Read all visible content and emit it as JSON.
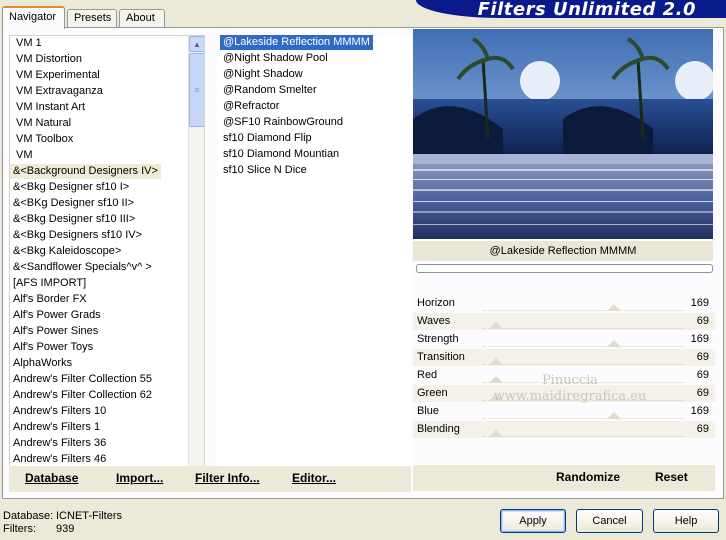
{
  "tabs": [
    "Navigator",
    "Presets",
    "About"
  ],
  "banner": "Filters Unlimited 2.0",
  "categories": [
    "VM 1",
    "VM Distortion",
    "VM Experimental",
    "VM Extravaganza",
    "VM Instant Art",
    "VM Natural",
    "VM Toolbox",
    "VM",
    "&<Background Designers IV>",
    "&<Bkg Designer sf10 I>",
    "&<BKg Designer sf10 II>",
    "&<Bkg Designer sf10 III>",
    "&<Bkg Designers sf10 IV>",
    "&<Bkg Kaleidoscope>",
    "&<Sandflower Specials^v^ >",
    "[AFS IMPORT]",
    "Alf's Border FX",
    "Alf's Power Grads",
    "Alf's Power Sines",
    "Alf's Power Toys",
    "AlphaWorks",
    "Andrew's Filter Collection 55",
    "Andrew's Filter Collection 62",
    "Andrew's Filters 10",
    "Andrew's Filters 1",
    "Andrew's Filters 36",
    "Andrew's Filters 46"
  ],
  "filters": [
    "@Lakeside Reflection MMMM",
    "@Night Shadow Pool",
    "@Night Shadow",
    "@Random Smelter",
    "@Refractor",
    "@SF10 RainbowGround",
    "sf10 Diamond Flip",
    "sf10 Diamond Mountian",
    "sf10 Slice N Dice"
  ],
  "selected_filter_label": "@Lakeside Reflection MMMM",
  "params": [
    {
      "label": "Horizon",
      "value": "169"
    },
    {
      "label": "Waves",
      "value": "69"
    },
    {
      "label": "Strength",
      "value": "169"
    },
    {
      "label": "Transition",
      "value": "69"
    },
    {
      "label": "Red",
      "value": "69"
    },
    {
      "label": "Green",
      "value": "69"
    },
    {
      "label": "Blue",
      "value": "169"
    },
    {
      "label": "Blending",
      "value": "69"
    }
  ],
  "watermark": {
    "line1": "Pinuccia",
    "line2": "www.maidiregrafica.eu"
  },
  "left_buttons": [
    "Database",
    "Import...",
    "Filter Info...",
    "Editor..."
  ],
  "right_buttons": [
    "Randomize",
    "Reset"
  ],
  "database": {
    "label": "Database:",
    "value": "ICNET-Filters"
  },
  "filters_count": {
    "label": "Filters:",
    "value": "939"
  },
  "dialog_buttons": {
    "apply": "Apply",
    "cancel": "Cancel",
    "help": "Help"
  },
  "icons": {
    "scroll_up": "scroll-up-arrow-icon",
    "scroll_down": "scroll-down-arrow-icon",
    "thumb_grip": "scroll-grip-icon"
  },
  "colors": {
    "banner": "#0a1a8a",
    "selection": "#316ac5",
    "tab_accent": "#e68b2c"
  }
}
